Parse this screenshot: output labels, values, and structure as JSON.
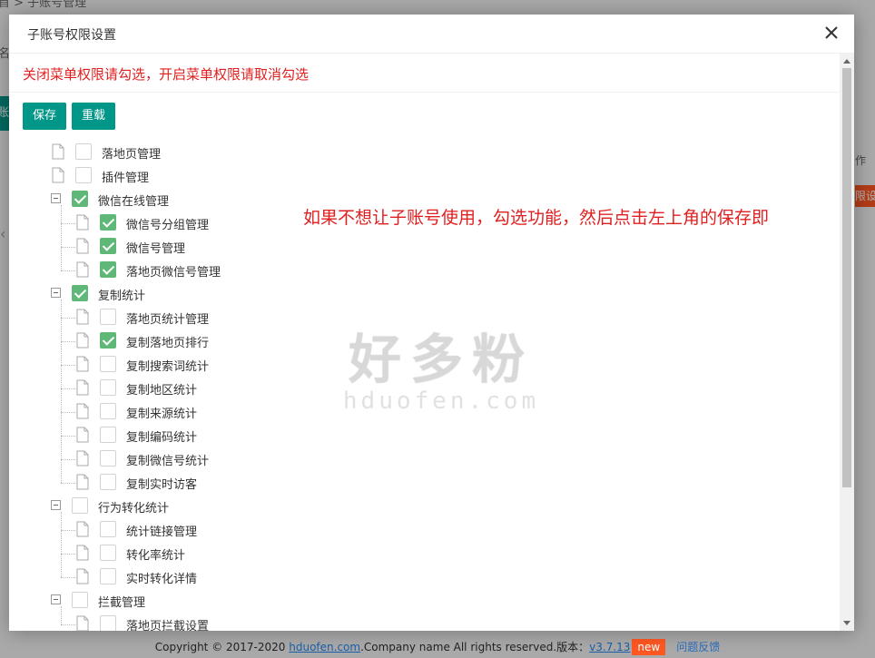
{
  "background": {
    "breadcrumb_fragment": "首 > 子账号管理",
    "name_fragment": "名",
    "button_fragment": "账",
    "right_mark": "作",
    "right_button_fragment": "限设"
  },
  "footer": {
    "copyright": "Copyright © 2017-2020 ",
    "domain_link": "hduofen.com",
    "company_text": ".Company name All rights reserved.版本：",
    "version_link": "v3.7.13",
    "new_badge": "new",
    "feedback_link": "问题反馈"
  },
  "modal": {
    "title": "子账号权限设置",
    "notice": "关闭菜单权限请勾选，开启菜单权限请取消勾选",
    "save_label": "保存",
    "reload_label": "重载",
    "annotation": "如果不想让子账号使用，勾选功能，然后点击左上角的保存即",
    "watermark_cn": "好多粉",
    "watermark_en": "hduofen.com"
  },
  "tree": [
    {
      "label": "落地页管理",
      "checked": false,
      "parent": false
    },
    {
      "label": "插件管理",
      "checked": false,
      "parent": false
    },
    {
      "label": "微信在线管理",
      "checked": true,
      "parent": true
    },
    {
      "label": "微信号分组管理",
      "checked": true,
      "child": true
    },
    {
      "label": "微信号管理",
      "checked": true,
      "child": true
    },
    {
      "label": "落地页微信号管理",
      "checked": true,
      "child": true
    },
    {
      "label": "复制统计",
      "checked": true,
      "parent": true
    },
    {
      "label": "落地页统计管理",
      "checked": false,
      "child": true
    },
    {
      "label": "复制落地页排行",
      "checked": true,
      "child": true
    },
    {
      "label": "复制搜索词统计",
      "checked": false,
      "child": true
    },
    {
      "label": "复制地区统计",
      "checked": false,
      "child": true
    },
    {
      "label": "复制来源统计",
      "checked": false,
      "child": true
    },
    {
      "label": "复制编码统计",
      "checked": false,
      "child": true
    },
    {
      "label": "复制微信号统计",
      "checked": false,
      "child": true
    },
    {
      "label": "复制实时访客",
      "checked": false,
      "child": true
    },
    {
      "label": "行为转化统计",
      "checked": false,
      "parent": true
    },
    {
      "label": "统计链接管理",
      "checked": false,
      "child": true
    },
    {
      "label": "转化率统计",
      "checked": false,
      "child": true
    },
    {
      "label": "实时转化详情",
      "checked": false,
      "child": true
    },
    {
      "label": "拦截管理",
      "checked": false,
      "parent": true
    },
    {
      "label": "落地页拦截设置",
      "checked": false,
      "child": true
    }
  ],
  "icons": {
    "close": "close-icon",
    "doc": "document-icon",
    "toggle": "collapse-icon"
  }
}
